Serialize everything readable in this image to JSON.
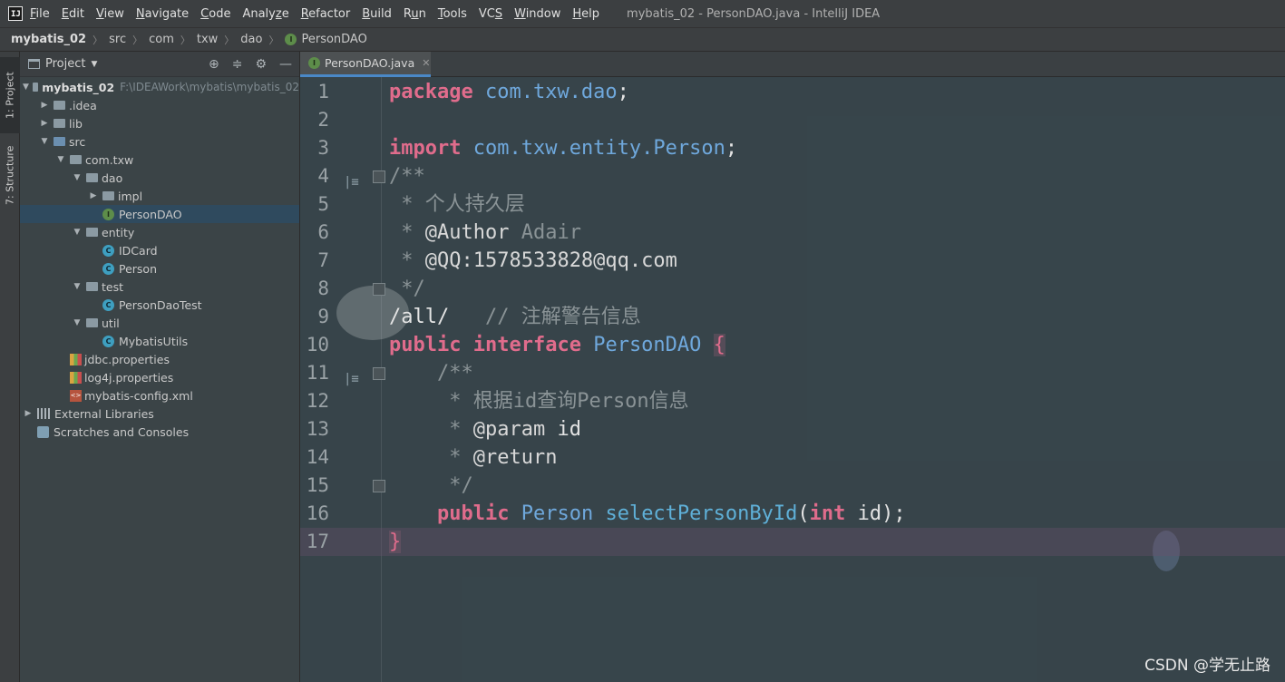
{
  "app": {
    "window_title": "mybatis_02 - PersonDAO.java - IntelliJ IDEA",
    "logo": "IJ"
  },
  "menu": [
    {
      "pre": "",
      "mn": "F",
      "post": "ile"
    },
    {
      "pre": "",
      "mn": "E",
      "post": "dit"
    },
    {
      "pre": "",
      "mn": "V",
      "post": "iew"
    },
    {
      "pre": "",
      "mn": "N",
      "post": "avigate"
    },
    {
      "pre": "",
      "mn": "C",
      "post": "ode"
    },
    {
      "pre": "Analy",
      "mn": "z",
      "post": "e"
    },
    {
      "pre": "",
      "mn": "R",
      "post": "efactor"
    },
    {
      "pre": "",
      "mn": "B",
      "post": "uild"
    },
    {
      "pre": "R",
      "mn": "u",
      "post": "n"
    },
    {
      "pre": "",
      "mn": "T",
      "post": "ools"
    },
    {
      "pre": "VC",
      "mn": "S",
      "post": ""
    },
    {
      "pre": "",
      "mn": "W",
      "post": "indow"
    },
    {
      "pre": "",
      "mn": "H",
      "post": "elp"
    }
  ],
  "breadcrumb": [
    "mybatis_02",
    "src",
    "com",
    "txw",
    "dao",
    "PersonDAO"
  ],
  "tool_tabs": {
    "project": "1: Project",
    "structure": "7: Structure"
  },
  "project_panel": {
    "title": "Project",
    "tree": [
      {
        "label": "mybatis_02",
        "path": "F:\\IDEAWork\\mybatis\\mybatis_02",
        "kind": "root",
        "depth": 0,
        "toggle": "▼"
      },
      {
        "label": ".idea",
        "kind": "folder",
        "depth": 1,
        "toggle": "▶"
      },
      {
        "label": "lib",
        "kind": "folder",
        "depth": 1,
        "toggle": "▶"
      },
      {
        "label": "src",
        "kind": "src",
        "depth": 1,
        "toggle": "▼"
      },
      {
        "label": "com.txw",
        "kind": "folder",
        "depth": 2,
        "toggle": "▼"
      },
      {
        "label": "dao",
        "kind": "folder",
        "depth": 3,
        "toggle": "▼"
      },
      {
        "label": "impl",
        "kind": "folder",
        "depth": 4,
        "toggle": "▶"
      },
      {
        "label": "PersonDAO",
        "kind": "interface",
        "depth": 4,
        "toggle": "",
        "selected": true
      },
      {
        "label": "entity",
        "kind": "folder",
        "depth": 3,
        "toggle": "▼"
      },
      {
        "label": "IDCard",
        "kind": "class",
        "depth": 4,
        "toggle": ""
      },
      {
        "label": "Person",
        "kind": "class",
        "depth": 4,
        "toggle": ""
      },
      {
        "label": "test",
        "kind": "folder",
        "depth": 3,
        "toggle": "▼"
      },
      {
        "label": "PersonDaoTest",
        "kind": "class",
        "depth": 4,
        "toggle": ""
      },
      {
        "label": "util",
        "kind": "folder",
        "depth": 3,
        "toggle": "▼"
      },
      {
        "label": "MybatisUtils",
        "kind": "class",
        "depth": 4,
        "toggle": ""
      },
      {
        "label": "jdbc.properties",
        "kind": "props",
        "depth": 2,
        "toggle": ""
      },
      {
        "label": "log4j.properties",
        "kind": "props",
        "depth": 2,
        "toggle": ""
      },
      {
        "label": "mybatis-config.xml",
        "kind": "xml",
        "depth": 2,
        "toggle": ""
      },
      {
        "label": "External Libraries",
        "kind": "lib",
        "depth": 0,
        "toggle": "▶"
      },
      {
        "label": "Scratches and Consoles",
        "kind": "scratch",
        "depth": 0,
        "toggle": ""
      }
    ]
  },
  "editor": {
    "tab_label": "PersonDAO.java",
    "current_line": 17,
    "lines": [
      {
        "n": "1",
        "tokens": [
          [
            "k",
            "package"
          ],
          [
            "plain",
            " "
          ],
          [
            "pk",
            "com.txw.dao"
          ],
          [
            "plain",
            ";"
          ]
        ]
      },
      {
        "n": "2",
        "tokens": []
      },
      {
        "n": "3",
        "tokens": [
          [
            "k",
            "import"
          ],
          [
            "plain",
            " "
          ],
          [
            "pk",
            "com.txw.entity.Person"
          ],
          [
            "plain",
            ";"
          ]
        ]
      },
      {
        "n": "4",
        "tokens": [
          [
            "cm",
            "/**"
          ]
        ]
      },
      {
        "n": "5",
        "tokens": [
          [
            "cm",
            " * 个人持久层"
          ]
        ]
      },
      {
        "n": "6",
        "tokens": [
          [
            "cm",
            " * "
          ],
          [
            "tag",
            "@Author"
          ],
          [
            "cm",
            " Adair"
          ]
        ]
      },
      {
        "n": "7",
        "tokens": [
          [
            "cm",
            " * "
          ],
          [
            "tag",
            "@QQ:1578533828@qq.com"
          ]
        ]
      },
      {
        "n": "8",
        "tokens": [
          [
            "cm",
            " */"
          ]
        ]
      },
      {
        "n": "9",
        "tokens": [
          [
            "plain",
            "/all/"
          ],
          [
            "cm",
            "   // 注解警告信息"
          ]
        ]
      },
      {
        "n": "10",
        "tokens": [
          [
            "k",
            "public"
          ],
          [
            "plain",
            " "
          ],
          [
            "k",
            "interface"
          ],
          [
            "plain",
            " "
          ],
          [
            "ty",
            "PersonDAO"
          ],
          [
            "plain",
            " "
          ],
          [
            "brace",
            "{"
          ]
        ]
      },
      {
        "n": "11",
        "tokens": [
          [
            "cm",
            "    /**"
          ]
        ]
      },
      {
        "n": "12",
        "tokens": [
          [
            "cm",
            "     * 根据id查询Person信息"
          ]
        ]
      },
      {
        "n": "13",
        "tokens": [
          [
            "cm",
            "     * "
          ],
          [
            "tag",
            "@param"
          ],
          [
            "plain",
            " id"
          ]
        ]
      },
      {
        "n": "14",
        "tokens": [
          [
            "cm",
            "     * "
          ],
          [
            "tag",
            "@return"
          ]
        ]
      },
      {
        "n": "15",
        "tokens": [
          [
            "cm",
            "     */"
          ]
        ]
      },
      {
        "n": "16",
        "tokens": [
          [
            "plain",
            "    "
          ],
          [
            "k",
            "public"
          ],
          [
            "plain",
            " "
          ],
          [
            "ty",
            "Person"
          ],
          [
            "plain",
            " "
          ],
          [
            "fn",
            "selectPersonById"
          ],
          [
            "plain",
            "("
          ],
          [
            "k",
            "int"
          ],
          [
            "plain",
            " id);"
          ]
        ]
      },
      {
        "n": "17",
        "tokens": [
          [
            "brace",
            "}"
          ]
        ]
      }
    ]
  },
  "watermark": "CSDN @学无止路",
  "colors": {
    "keyword": "#e06c8c",
    "type": "#6fa8dc",
    "comment": "#8a9396",
    "selection": "#2f4a5e"
  }
}
